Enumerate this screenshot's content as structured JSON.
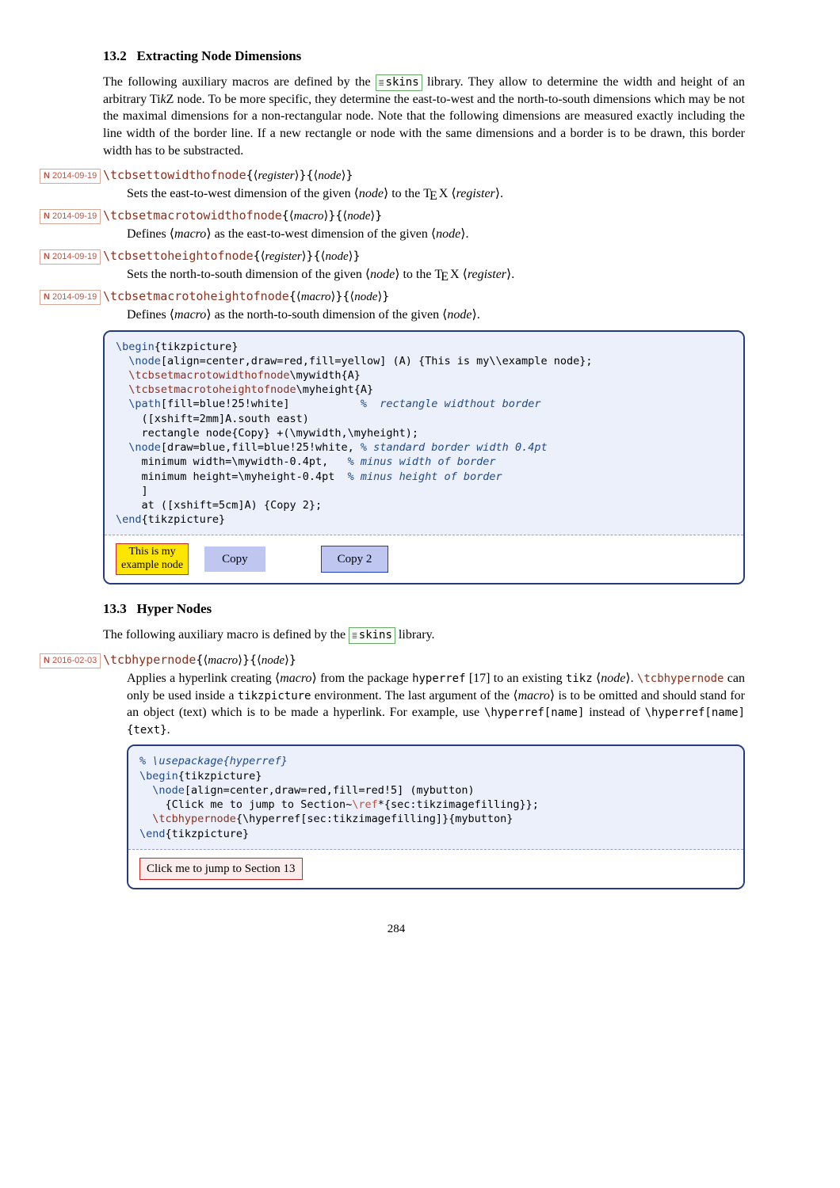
{
  "section132": {
    "number": "13.2",
    "title": "Extracting Node Dimensions",
    "intro_a": "The following auxiliary macros are defined by the ",
    "lib_label": "skins",
    "intro_b": " library. They allow to determine the width and height of an arbitrary Ti",
    "tikz_k": "k",
    "intro_c": "Z node. To be more specific, they determine the east-to-west and the north-to-south dimensions which may be not the maximal dimensions for a non-rectangular node. Note that the following dimensions are measured exactly including the line width of the border line. If a new rectangle or node with the same dimensions and a border is to be drawn, this border width has to be substracted."
  },
  "entries": [
    {
      "date": "2014-09-19",
      "cmd": "\\tcbsettowidthofnode",
      "arg1": "register",
      "arg2": "node",
      "desc_a": "Sets the east-to-west dimension of the given ",
      "desc_b": " to the ",
      "desc_c": "."
    },
    {
      "date": "2014-09-19",
      "cmd": "\\tcbsetmacrotowidthofnode",
      "arg1": "macro",
      "arg2": "node",
      "desc_a": "Defines ",
      "desc_b": " as the east-to-west dimension of the given ",
      "desc_c": "."
    },
    {
      "date": "2014-09-19",
      "cmd": "\\tcbsettoheightofnode",
      "arg1": "register",
      "arg2": "node",
      "desc_a": "Sets the north-to-south dimension of the given ",
      "desc_b": " to the ",
      "desc_c": "."
    },
    {
      "date": "2014-09-19",
      "cmd": "\\tcbsetmacrotoheightofnode",
      "arg1": "macro",
      "arg2": "node",
      "desc_a": "Defines ",
      "desc_b": " as the north-to-south dimension of the given ",
      "desc_c": "."
    }
  ],
  "code1": {
    "l1a": "\\begin",
    "l1b": "{tikzpicture}",
    "l2a": "  \\node",
    "l2b": "[align=center,draw=red,fill=yellow] (A) {This is my\\\\example node};",
    "l3a": "  \\tcbsetmacrotowidthofnode",
    "l3b": "\\mywidth{A}",
    "l4a": "  \\tcbsetmacrotoheightofnode",
    "l4b": "\\myheight{A}",
    "l5a": "  \\path",
    "l5b": "[fill=blue!25!white]           ",
    "l5c": "%  rectangle widthout border",
    "l6": "    ([xshift=2mm]A.south east)",
    "l7": "    rectangle node{Copy} +(\\mywidth,\\myheight);",
    "l8a": "  \\node",
    "l8b": "[draw=blue,fill=blue!25!white, ",
    "l8c": "% standard border width 0.4pt",
    "l9a": "    minimum width=\\mywidth-0.4pt,   ",
    "l9b": "% minus width of border",
    "l10a": "    minimum height=\\myheight-0.4pt  ",
    "l10b": "% minus height of border",
    "l11": "    ]",
    "l12": "    at ([xshift=5cm]A) {Copy 2};",
    "l13a": "\\end",
    "l13b": "{tikzpicture}"
  },
  "output1": {
    "node_a_l1": "This is my",
    "node_a_l2": "example node",
    "copy": "Copy",
    "copy2": "Copy 2"
  },
  "section133": {
    "number": "13.3",
    "title": "Hyper Nodes",
    "intro_a": "The following auxiliary macro is defined by the ",
    "intro_b": " library."
  },
  "entry5": {
    "date": "2016-02-03",
    "cmd": "\\tcbhypernode",
    "arg1": "macro",
    "arg2": "node",
    "desc_a": "Applies a hyperlink creating ",
    "desc_b": " from the package ",
    "pkg": "hyperref",
    "cite": "[17]",
    "desc_c": " to an existing ",
    "pkg2": "tikz",
    "desc_d": ". ",
    "linkname": "\\tcbhypernode",
    "desc_e": " can only be used inside a ",
    "env": "tikzpicture",
    "desc_f": " environment. The last argument of the ",
    "desc_g": " is to be omitted and should stand for an object (text) which is to be made a hyperlink. For example, use ",
    "ex1": "\\hyperref[name]",
    "desc_h": " instead of ",
    "ex2": "\\hyperref[name]{text}",
    "desc_i": "."
  },
  "code2": {
    "l1": "% \\usepackage{hyperref}",
    "l2a": "\\begin",
    "l2b": "{tikzpicture}",
    "l3a": "  \\node",
    "l3b": "[align=center,draw=red,fill=red!5] (mybutton)",
    "l4a": "    {Click me to jump to Section~",
    "l4b": "\\ref",
    "l4c": "*{sec:tikzimagefilling}};",
    "l5a": "  \\tcbhypernode",
    "l5b": "{\\hyperref[sec:tikzimagefilling]}{mybutton}",
    "l6a": "\\end",
    "l6b": "{tikzpicture}"
  },
  "output2": {
    "button_text": "Click me to jump to Section 13"
  },
  "tex_label": {
    "t": "T",
    "e": "E",
    "x": "X"
  },
  "page_number": "284",
  "words": {
    "node": "node",
    "register": "register",
    "macro": "macro",
    "lang": "⟨",
    "rang": "⟩"
  }
}
